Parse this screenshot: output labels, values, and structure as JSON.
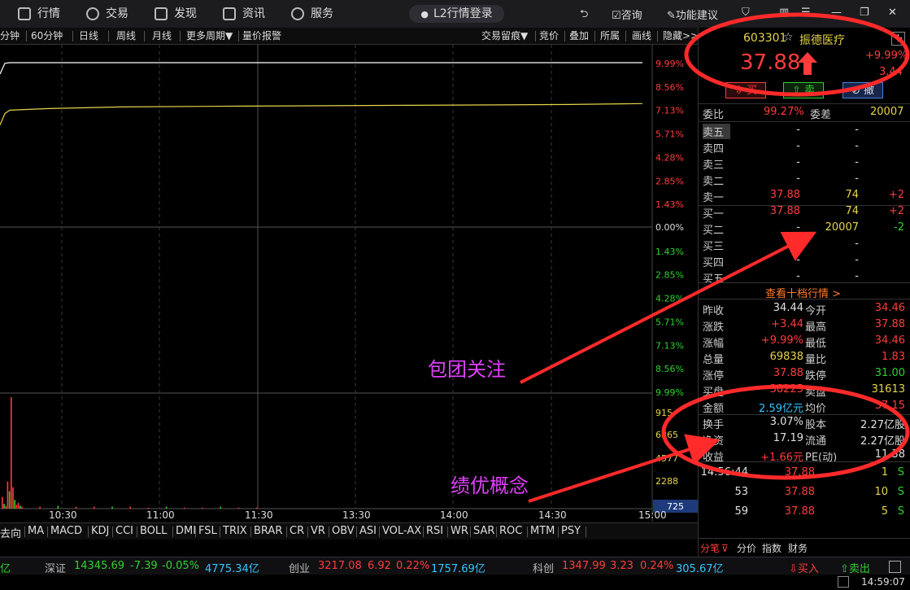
{
  "topbar": {
    "menus": [
      "行情",
      "交易",
      "发现",
      "资讯",
      "服务"
    ],
    "login": "L2行情登录",
    "consult": "咨询",
    "feature": "功能建议"
  },
  "periodbar": {
    "items": [
      "分钟",
      "60分钟",
      "日线",
      "周线",
      "月线",
      "更多周期▼",
      "量价报警"
    ],
    "right_items": [
      "交易留痕▼",
      "竞价",
      "叠加",
      "所属",
      "画线",
      "隐藏>>"
    ]
  },
  "chart_data": {
    "type": "line",
    "series": [
      {
        "name": "",
        "values": [
          9.3,
          9.95,
          9.99,
          9.99,
          9.99,
          9.99,
          9.99,
          9.99,
          9.99
        ]
      },
      {
        "name": "",
        "values": [
          6.2,
          6.9,
          7.1,
          7.2,
          7.3,
          7.35,
          7.4,
          7.45,
          7.5
        ]
      }
    ],
    "x_ticks": [
      "10:30",
      "11:00",
      "11:30",
      "13:30",
      "14:00",
      "14:30",
      "15:00"
    ],
    "y_labels_up": [
      "9.99%",
      "8.56%",
      "7.13%",
      "5.71%",
      "4.28%",
      "2.85%",
      "1.43%"
    ],
    "y_label_zero": "0.00%",
    "y_labels_down": [
      "1.43%",
      "2.85%",
      "4.28%",
      "5.71%",
      "7.13%",
      "8.56%",
      "9.99%"
    ],
    "volume_labels": [
      "915",
      "6865",
      "4577",
      "2288"
    ],
    "volume_current": "725",
    "volume_bars": [
      12,
      5,
      3,
      28,
      18,
      115,
      22,
      9,
      4,
      6,
      3,
      2,
      2,
      3,
      2,
      2,
      2,
      2,
      1,
      2,
      1,
      1,
      2,
      1,
      1
    ],
    "grid": true
  },
  "indicators": [
    "去向",
    "MA",
    "MACD",
    "KDJ",
    "CCI",
    "BOLL",
    "DMI",
    "FSL",
    "TRIX",
    "BRAR",
    "CR",
    "VR",
    "OBV",
    "ASI",
    "VOL-AX",
    "RSI",
    "WR",
    "SAR",
    "ROC",
    "MTM",
    "PSY"
  ],
  "stock": {
    "code": "603301",
    "name": "振德医疗",
    "price": "37.88",
    "change_pct": "+9.99%",
    "change": "3.44",
    "buy_label": "买",
    "sell_label": "卖",
    "cancel_label": "撤"
  },
  "order_book": {
    "weibi_label": "委比",
    "weibi": "99.27%",
    "weicha_label": "委差",
    "weicha": "20007",
    "asks": [
      {
        "label": "卖五",
        "price": "-",
        "vol": "-",
        "chg": ""
      },
      {
        "label": "卖四",
        "price": "-",
        "vol": "-",
        "chg": ""
      },
      {
        "label": "卖三",
        "price": "-",
        "vol": "-",
        "chg": ""
      },
      {
        "label": "卖二",
        "price": "-",
        "vol": "-",
        "chg": ""
      },
      {
        "label": "卖一",
        "price": "37.88",
        "vol": "74",
        "chg": "+2"
      }
    ],
    "bids": [
      {
        "label": "买一",
        "price": "37.88",
        "vol": "74",
        "chg": "+2"
      },
      {
        "label": "买二",
        "price": "-",
        "vol": "20007",
        "chg": "-2"
      },
      {
        "label": "买三",
        "price": "-",
        "vol": "-",
        "chg": ""
      },
      {
        "label": "买四",
        "price": "-",
        "vol": "-",
        "chg": ""
      },
      {
        "label": "买五",
        "price": "-",
        "vol": "-",
        "chg": ""
      }
    ],
    "more_link": "查看十档行情 >"
  },
  "stats": [
    {
      "l1": "昨收",
      "v1": "34.44",
      "l2": "今开",
      "v2": "34.46"
    },
    {
      "l1": "涨跌",
      "v1": "+3.44",
      "l2": "最高",
      "v2": "37.88"
    },
    {
      "l1": "涨幅",
      "v1": "+9.99%",
      "l2": "最低",
      "v2": "34.46"
    },
    {
      "l1": "总量",
      "v1": "69838",
      "l2": "量比",
      "v2": "1.83"
    },
    {
      "l1": "涨停",
      "v1": "37.88",
      "l2": "跌停",
      "v2": "31.00"
    },
    {
      "l1": "买盘",
      "v1": "38225",
      "l2": "卖盘",
      "v2": "31613"
    },
    {
      "l1": "金额",
      "v1": "2.59亿元",
      "l2": "均价",
      "v2": "37.15"
    },
    {
      "l1": "换手",
      "v1": "3.07%",
      "l2": "股本",
      "v2": "2.27亿股"
    },
    {
      "l1": "净资",
      "v1": "17.19",
      "l2": "流通",
      "v2": "2.27亿股"
    },
    {
      "l1": "收益",
      "v1": "+1.66元",
      "l2": "PE(动)",
      "v2": "11.38"
    }
  ],
  "ticks": [
    {
      "time": "14:56:44",
      "price": "37.88",
      "vol": "1",
      "side": "S"
    },
    {
      "time": "53",
      "price": "37.88",
      "vol": "10",
      "side": "S"
    },
    {
      "time": "59",
      "price": "37.88",
      "vol": "5",
      "side": "S"
    }
  ],
  "rp_tabs": [
    "分笔",
    "分价",
    "指数",
    "财务"
  ],
  "statusbar": {
    "sz_label": "深证",
    "sz_val": "14345.69",
    "sz_chg": "-7.39",
    "sz_pct": "-0.05%",
    "sz_amt": "4775.34亿",
    "cy_label": "创业",
    "cy_val": "3217.08",
    "cy_chg": "6.92",
    "cy_pct": "0.22%",
    "cy_amt": "1757.69亿",
    "kc_label": "科创",
    "kc_val": "1347.99",
    "kc_chg": "3.23",
    "kc_pct": "0.24%",
    "kc_amt": "305.67亿",
    "buy_btn": "买入",
    "sell_btn": "卖出",
    "left_edge": "亿"
  },
  "clock": "14:59:07",
  "annotations": {
    "a1": "包团关注",
    "a2": "绩优概念"
  },
  "colors": {
    "up": "#ff3b3b",
    "down": "#2ed12e",
    "price_line": "#ffffff",
    "avg_line": "#e6d44a",
    "annotation": "#e040fb"
  }
}
